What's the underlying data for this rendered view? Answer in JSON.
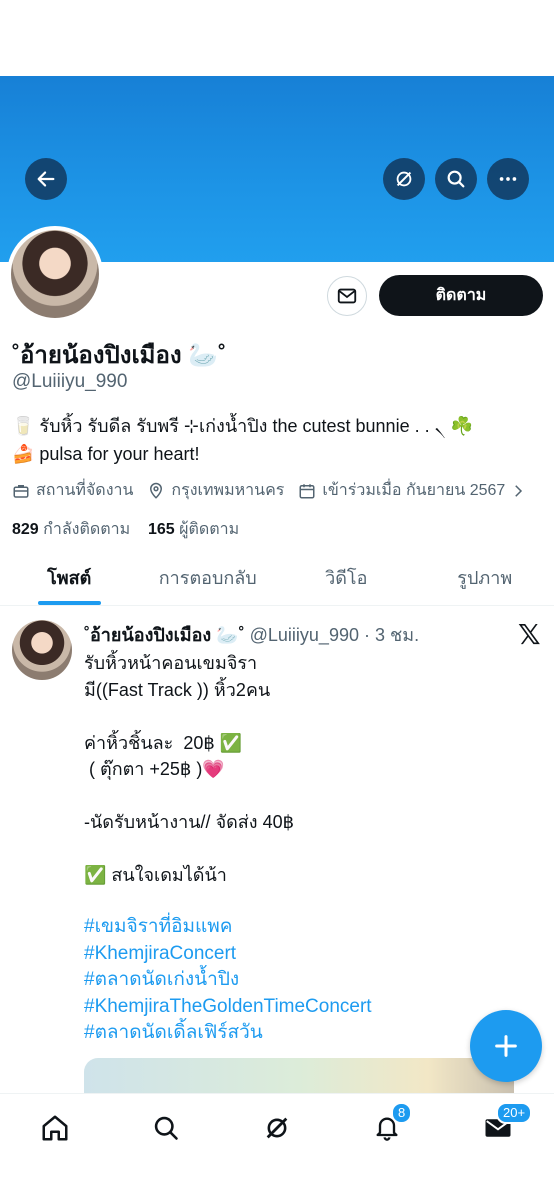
{
  "header": {
    "back_icon": "arrow-left-icon",
    "grok_icon": "grok-icon",
    "search_icon": "search-icon",
    "more_icon": "more-horizontal-icon"
  },
  "profile": {
    "name": "˚อ้ายน้องปิงเมือง 🦢˚",
    "handle": "@Luiiiyu_990",
    "follow_label": "ติดตาม",
    "bio_line1": "🥛 รับหิ้ว รับดีล รับพรี ⊹เก่งน้ำปิง the cutest bunnie . . ৲ ☘️",
    "bio_line2": "🍰 pulsa for your heart!",
    "meta_category": "สถานที่จัดงาน",
    "meta_location": "กรุงเทพมหานคร",
    "meta_joined": "เข้าร่วมเมื่อ กันยายน 2567",
    "following_count": "829",
    "following_label": "กำลังติดตาม",
    "followers_count": "165",
    "followers_label": "ผู้ติดตาม"
  },
  "tabs": [
    "โพสต์",
    "การตอบกลับ",
    "วิดีโอ",
    "รูปภาพ"
  ],
  "post": {
    "name": "˚อ้ายน้องปิงเมือง 🦢˚",
    "handle": "@Luiiiyu_990",
    "time": "· 3 ชม.",
    "lines": [
      "รับหิ้วหน้าคอนเขมจิรา",
      "มี((Fast Track )) หิ้ว2คน",
      "",
      "ค่าหิ้วชิ้นละ  20฿ ✅",
      " ( ตุ๊กตา +25฿ )💗",
      "",
      "-นัดรับหน้างาน// จัดส่ง 40฿",
      "",
      "✅ สนใจเดมได้น้า",
      ""
    ],
    "hashtags": [
      "#เขมจิราที่อิมแพค",
      "#KhemjiraConcert",
      "#ตลาดนัดเก่งน้ำปิง",
      "#KhemjiraTheGoldenTimeConcert",
      "#ตลาดนัดเดิ้ลเฟิร์สวัน"
    ]
  },
  "bottom_nav": {
    "notifications_badge": "8",
    "messages_badge": "20+"
  },
  "colors": {
    "accent": "#1d9bf0",
    "banner": "#1d94e6",
    "text": "#0f1419",
    "muted": "#536471"
  }
}
